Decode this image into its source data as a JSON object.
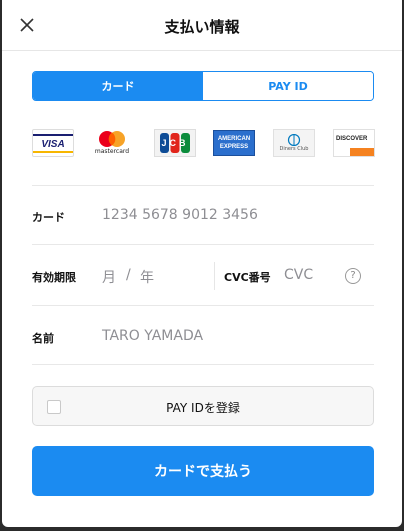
{
  "header": {
    "title": "支払い情報",
    "close_icon": "close-icon"
  },
  "tabs": [
    {
      "label": "カード",
      "active": true
    },
    {
      "label": "PAY ID",
      "active": false
    }
  ],
  "brands": {
    "visa": "VISA",
    "mastercard": "mastercard",
    "jcb": "JCB",
    "amex_line1": "AMERICAN",
    "amex_line2": "EXPRESS",
    "diners": "Diners Club",
    "discover": "DISCOVER"
  },
  "form": {
    "card_label": "カード",
    "card_placeholder": "1234 5678 9012 3456",
    "expiry_label": "有効期限",
    "expiry_month": "月",
    "expiry_sep": "/",
    "expiry_year": "年",
    "cvc_label": "CVC番号",
    "cvc_placeholder": "CVC",
    "cvc_help": "?",
    "name_label": "名前",
    "name_placeholder": "TARO YAMADA"
  },
  "register": {
    "label": "PAY IDを登録",
    "checked": false
  },
  "pay_button": {
    "label": "カードで支払う"
  },
  "colors": {
    "accent": "#1b8bf1",
    "divider": "#e8e8e8",
    "placeholder": "#8e8e93"
  }
}
